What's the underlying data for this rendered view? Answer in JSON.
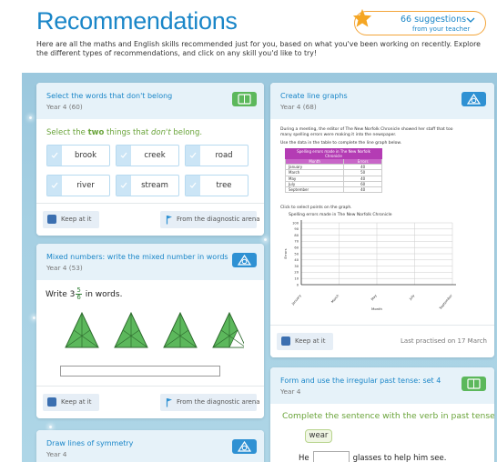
{
  "header": {
    "title": "Recommendations",
    "intro": "Here are all the maths and English skills recommended just for you, based on what you've been working on recently. Explore the different types of recommendations, and click on any skill you'd like to try!",
    "suggestions": {
      "count_label": "66 suggestions",
      "from_label": "from your teacher"
    }
  },
  "colors": {
    "accent": "#1a86c8",
    "english_badge": "#5cb85c",
    "maths_badge": "#2f91d3",
    "instruction": "#6aa43a"
  },
  "cards": {
    "dont_belong": {
      "title": "Select the words that don't belong",
      "subtitle": "Year 4 (60)",
      "badge_icon": "book-icon",
      "instruction_pre": "Select the ",
      "instruction_bold": "two",
      "instruction_mid": " things that ",
      "instruction_ital": "don't",
      "instruction_post": " belong.",
      "options": [
        "brook",
        "creek",
        "road",
        "river",
        "stream",
        "tree"
      ],
      "keep_label": "Keep at it",
      "diag_label": "From the diagnostic arena"
    },
    "mixed_numbers": {
      "title": "Mixed numbers: write the mixed number in words",
      "subtitle": "Year 4 (53)",
      "badge_icon": "shapes-icon",
      "write_pre": "Write 3",
      "frac_num": "5",
      "frac_den": "6",
      "write_post": "in words.",
      "keep_label": "Keep at it",
      "diag_label": "From the diagnostic arena"
    },
    "symmetry": {
      "title": "Draw lines of symmetry",
      "subtitle": "Year 4",
      "badge_icon": "shapes-icon"
    },
    "line_graphs": {
      "title": "Create line graphs",
      "subtitle": "Year 4 (68)",
      "badge_icon": "shapes-icon",
      "para": "During a meeting, the editor of The New Norfolk Chronicle showed her staff that too many spelling errors were making it into the newspaper.",
      "use_data": "Use the data in the table to complete the line graph below.",
      "table_caption": "Spelling errors made in The New Norfolk Chronicle",
      "table_headers": [
        "Month",
        "Errors"
      ],
      "table_rows": [
        [
          "January",
          "40"
        ],
        [
          "March",
          "50"
        ],
        [
          "May",
          "40"
        ],
        [
          "July",
          "60"
        ],
        [
          "September",
          "40"
        ]
      ],
      "click_label": "Click to select points on the graph.",
      "graph_title": "Spelling errors made in The New Norfolk Chronicle",
      "y_axis": "Errors",
      "x_axis": "Month",
      "y_ticks": [
        "100",
        "90",
        "80",
        "70",
        "60",
        "50",
        "40",
        "30",
        "20",
        "10",
        "0"
      ],
      "x_ticks": [
        "January",
        "March",
        "May",
        "July",
        "September"
      ],
      "keep_label": "Keep at it",
      "practised": "Last practised on 17 March"
    },
    "past_tense": {
      "title": "Form and use the irregular past tense: set 4",
      "subtitle": "Year 4",
      "badge_icon": "book-icon",
      "instruction": "Complete the sentence with the verb in past tense.",
      "word": "wear",
      "sentence_pre": "He",
      "sentence_post": "glasses to help him see."
    }
  }
}
